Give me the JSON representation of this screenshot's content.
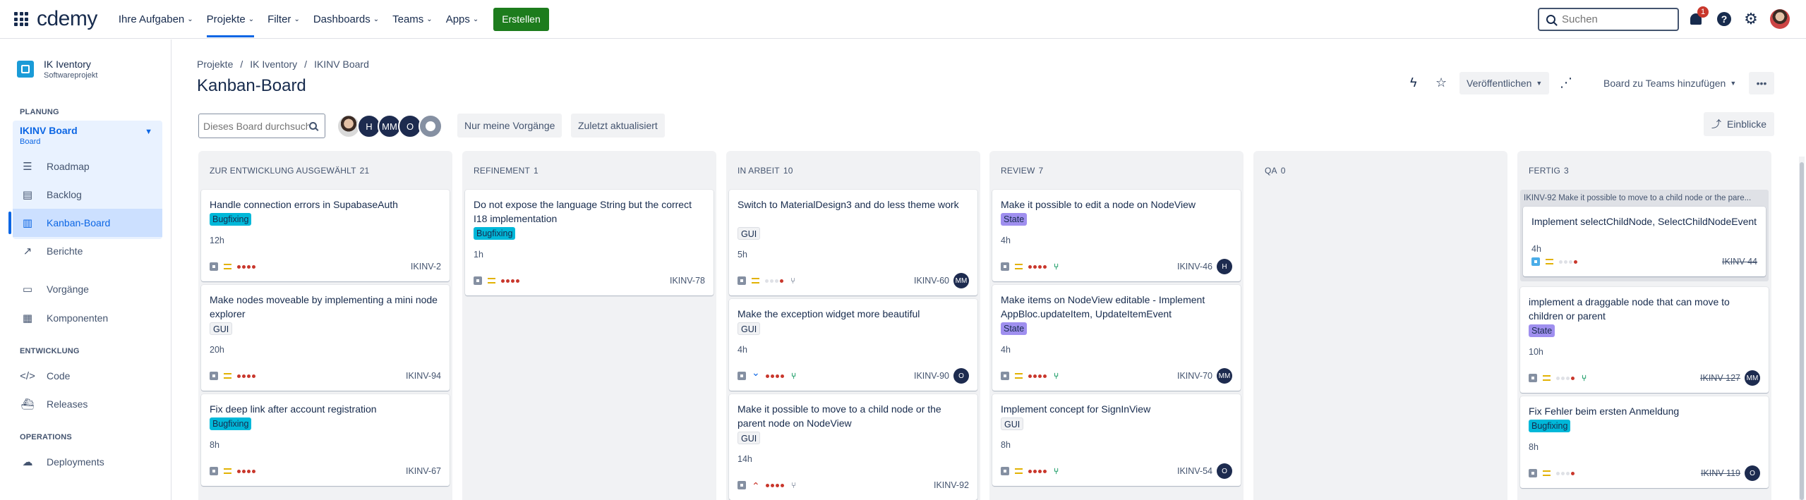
{
  "nav": {
    "logo": "cdemy",
    "items": [
      {
        "label": "Ihre Aufgaben"
      },
      {
        "label": "Projekte"
      },
      {
        "label": "Filter"
      },
      {
        "label": "Dashboards"
      },
      {
        "label": "Teams"
      },
      {
        "label": "Apps"
      }
    ],
    "create_label": "Erstellen",
    "search_placeholder": "Suchen",
    "notification_count": "1",
    "help_label": "?"
  },
  "sidebar": {
    "project_name": "IK Iventory",
    "project_type": "Softwareprojekt",
    "section_planning": "PLANUNG",
    "board_name": "IKINV Board",
    "board_type": "Board",
    "planning_items": [
      {
        "label": "Roadmap"
      },
      {
        "label": "Backlog"
      },
      {
        "label": "Kanban-Board"
      },
      {
        "label": "Berichte"
      }
    ],
    "other_items": [
      {
        "label": "Vorgänge"
      },
      {
        "label": "Komponenten"
      }
    ],
    "section_dev": "ENTWICKLUNG",
    "dev_items": [
      {
        "label": "Code"
      },
      {
        "label": "Releases"
      }
    ],
    "section_ops": "OPERATIONS",
    "ops_items": [
      {
        "label": "Deployments"
      }
    ]
  },
  "header": {
    "breadcrumbs": [
      "Projekte",
      "IK Iventory",
      "IKINV Board"
    ],
    "title": "Kanban-Board",
    "publish_label": "Veröffentlichen",
    "add_to_teams_label": "Board zu Teams hinzufügen",
    "more_label": "•••"
  },
  "toolbar": {
    "search_placeholder": "Dieses Board durchsuchen",
    "avatars": [
      "H",
      "MM",
      "O"
    ],
    "filter_mine": "Nur meine Vorgänge",
    "filter_recent": "Zuletzt aktualisiert",
    "insights_label": "Einblicke"
  },
  "columns": [
    {
      "name": "ZUR ENTWICKLUNG AUSGEWÄHLT",
      "count": "21",
      "cards": [
        {
          "title": "Handle connection errors in SupabaseAuth",
          "tag": "Bugfixing",
          "tag_type": "bug",
          "estimate": "12h",
          "key": "IKINV-2",
          "priority": "medium",
          "dots": "red",
          "assignee": "",
          "branch": ""
        },
        {
          "title": "Make nodes moveable by implementing a mini node explorer",
          "tag": "GUI",
          "tag_type": "gui",
          "estimate": "20h",
          "key": "IKINV-94",
          "priority": "medium",
          "dots": "red",
          "assignee": "",
          "branch": ""
        },
        {
          "title": "Fix deep link after account registration",
          "tag": "Bugfixing",
          "tag_type": "bug",
          "estimate": "8h",
          "key": "IKINV-67",
          "priority": "medium",
          "dots": "red",
          "assignee": "",
          "branch": ""
        }
      ]
    },
    {
      "name": "REFINEMENT",
      "count": "1",
      "cards": [
        {
          "title": "Do not expose the language String but the correct I18 implementation",
          "tag": "Bugfixing",
          "tag_type": "bug",
          "estimate": "1h",
          "key": "IKINV-78",
          "priority": "medium",
          "dots": "red",
          "assignee": "",
          "branch": ""
        }
      ]
    },
    {
      "name": "IN ARBEIT",
      "count": "10",
      "cards": [
        {
          "title": "Switch to MaterialDesign3 and do less theme work",
          "tag": "GUI",
          "tag_type": "gui",
          "estimate": "5h",
          "key": "IKINV-60",
          "priority": "medium",
          "dots": "mix",
          "assignee": "MM",
          "branch": "grey"
        },
        {
          "title": "Make the exception widget more beautiful",
          "tag": "GUI",
          "tag_type": "gui",
          "estimate": "4h",
          "key": "IKINV-90",
          "priority": "low",
          "dots": "red",
          "assignee": "O",
          "branch": "green"
        },
        {
          "title": "Make it possible to move to a child node or the parent node on NodeView",
          "tag": "GUI",
          "tag_type": "gui",
          "estimate": "14h",
          "key": "IKINV-92",
          "priority": "high",
          "dots": "red",
          "assignee": "",
          "branch": "grey"
        }
      ]
    },
    {
      "name": "REVIEW",
      "count": "7",
      "cards": [
        {
          "title": "Make it possible to edit a node on NodeView",
          "tag": "State",
          "tag_type": "state",
          "estimate": "4h",
          "key": "IKINV-46",
          "priority": "medium",
          "dots": "red",
          "assignee": "H",
          "branch": "green"
        },
        {
          "title": "Make items on NodeView editable - Implement AppBloc.updateItem, UpdateItemEvent",
          "tag": "State",
          "tag_type": "state",
          "estimate": "4h",
          "key": "IKINV-70",
          "priority": "medium",
          "dots": "red",
          "assignee": "MM",
          "branch": "green"
        },
        {
          "title": "Implement concept for SignInView",
          "tag": "GUI",
          "tag_type": "gui",
          "estimate": "8h",
          "key": "IKINV-54",
          "priority": "medium",
          "dots": "red",
          "assignee": "O",
          "branch": "green"
        }
      ]
    },
    {
      "name": "QA",
      "count": "0",
      "cards": []
    },
    {
      "name": "FERTIG",
      "count": "3",
      "parent_header": "IKINV-92 Make it possible to move to a child node or the pare...",
      "cards": [
        {
          "title": "Implement selectChildNode, SelectChildNodeEvent",
          "tag": "",
          "tag_type": "",
          "estimate": "4h",
          "key": "IKINV-44",
          "priority": "medium",
          "dots": "mix",
          "assignee": "",
          "branch": ""
        },
        {
          "title": "implement a draggable node that can move to children or parent",
          "tag": "State",
          "tag_type": "state",
          "estimate": "10h",
          "key": "IKINV-127",
          "priority": "medium",
          "dots": "mix",
          "assignee": "MM",
          "branch": "green"
        },
        {
          "title": "Fix Fehler beim ersten Anmeldung",
          "tag": "Bugfixing",
          "tag_type": "bug",
          "estimate": "8h",
          "key": "IKINV-119",
          "priority": "medium",
          "dots": "mix",
          "assignee": "O",
          "branch": ""
        }
      ]
    }
  ]
}
